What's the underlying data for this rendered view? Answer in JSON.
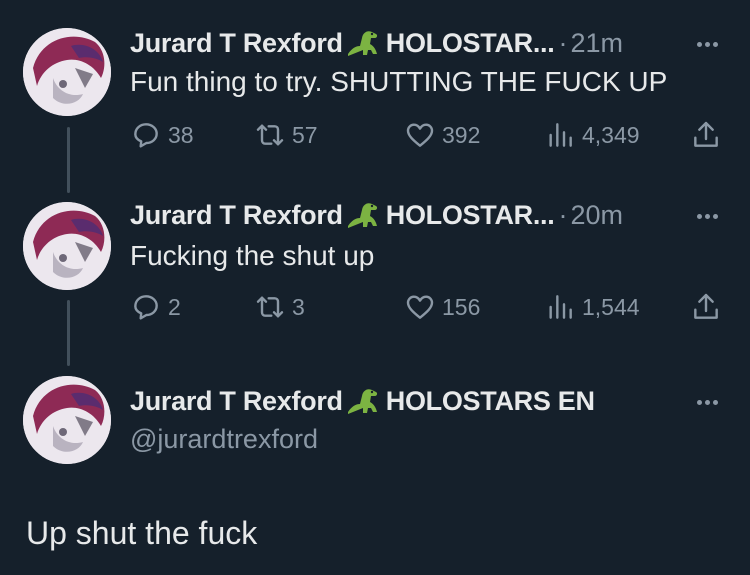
{
  "tweets": [
    {
      "name": "Jurard T Rexford",
      "affiliation": "HOLOSTAR...",
      "separator": "·",
      "time": "21m",
      "text": "Fun thing to try. SHUTTING THE FUCK UP",
      "replies": "38",
      "retweets": "57",
      "likes": "392",
      "views": "4,349"
    },
    {
      "name": "Jurard T Rexford",
      "affiliation": "HOLOSTAR...",
      "separator": "·",
      "time": "20m",
      "text": "Fucking the shut up",
      "replies": "2",
      "retweets": "3",
      "likes": "156",
      "views": "1,544"
    },
    {
      "name": "Jurard T Rexford",
      "affiliation": "HOLOSTARS EN",
      "handle": "@jurardtrexford",
      "text": "Up shut the fuck"
    }
  ],
  "icons": {
    "reply": "reply-icon",
    "retweet": "retweet-icon",
    "like": "heart-icon",
    "views": "views-icon",
    "share": "share-icon",
    "more": "more-icon",
    "dino": "dinosaur-emoji-icon"
  },
  "colors": {
    "background": "#15202b",
    "text": "#e7e9ea",
    "secondary": "#8b98a5",
    "thread_line": "#42505c"
  }
}
